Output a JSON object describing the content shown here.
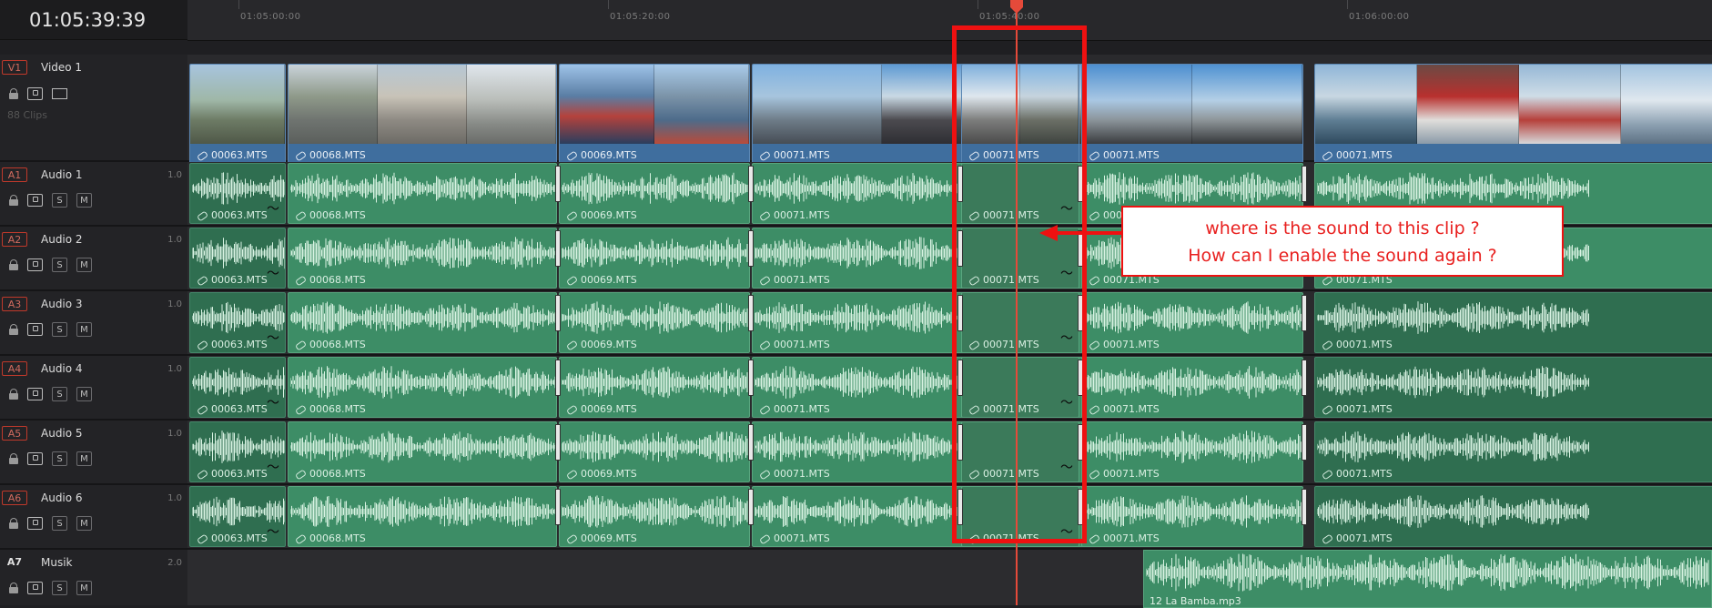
{
  "timecode": "01:05:39:39",
  "ruler": {
    "labels": [
      "01:05:00:00",
      "01:05:20:00",
      "01:05:40:00",
      "01:06:00:00"
    ]
  },
  "tracks": {
    "video": {
      "badge": "V1",
      "name": "Video 1",
      "clip_count": "88 Clips"
    },
    "audio": [
      {
        "badge": "A1",
        "name": "Audio 1",
        "level": "1.0"
      },
      {
        "badge": "A2",
        "name": "Audio 2",
        "level": "1.0"
      },
      {
        "badge": "A3",
        "name": "Audio 3",
        "level": "1.0"
      },
      {
        "badge": "A4",
        "name": "Audio 4",
        "level": "1.0"
      },
      {
        "badge": "A5",
        "name": "Audio 5",
        "level": "1.0"
      },
      {
        "badge": "A6",
        "name": "Audio 6",
        "level": "1.0"
      }
    ],
    "music": {
      "badge": "A7",
      "name": "Musik",
      "level": "2.0"
    },
    "solo_label": "S",
    "mute_label": "M"
  },
  "video_clips": [
    "00063.MTS",
    "00068.MTS",
    "00069.MTS",
    "00071.MTS",
    "00071.MTS",
    "00071.MTS",
    "00071.MTS"
  ],
  "audio_clips": [
    "00063.MTS",
    "00068.MTS",
    "00069.MTS",
    "00071.MTS",
    "00071.MTS",
    "00071.MTS",
    "00071.MTS"
  ],
  "music_clip": "12 La Bamba.mp3",
  "callout": {
    "line1": "where is the sound to this clip ?",
    "line2": "How can I enable the sound again ?"
  },
  "colors": {
    "video_clip": "#3f6e9e",
    "audio_clip": "#3d8d66",
    "playhead": "#e54a3a",
    "annotation": "#ee1111"
  }
}
